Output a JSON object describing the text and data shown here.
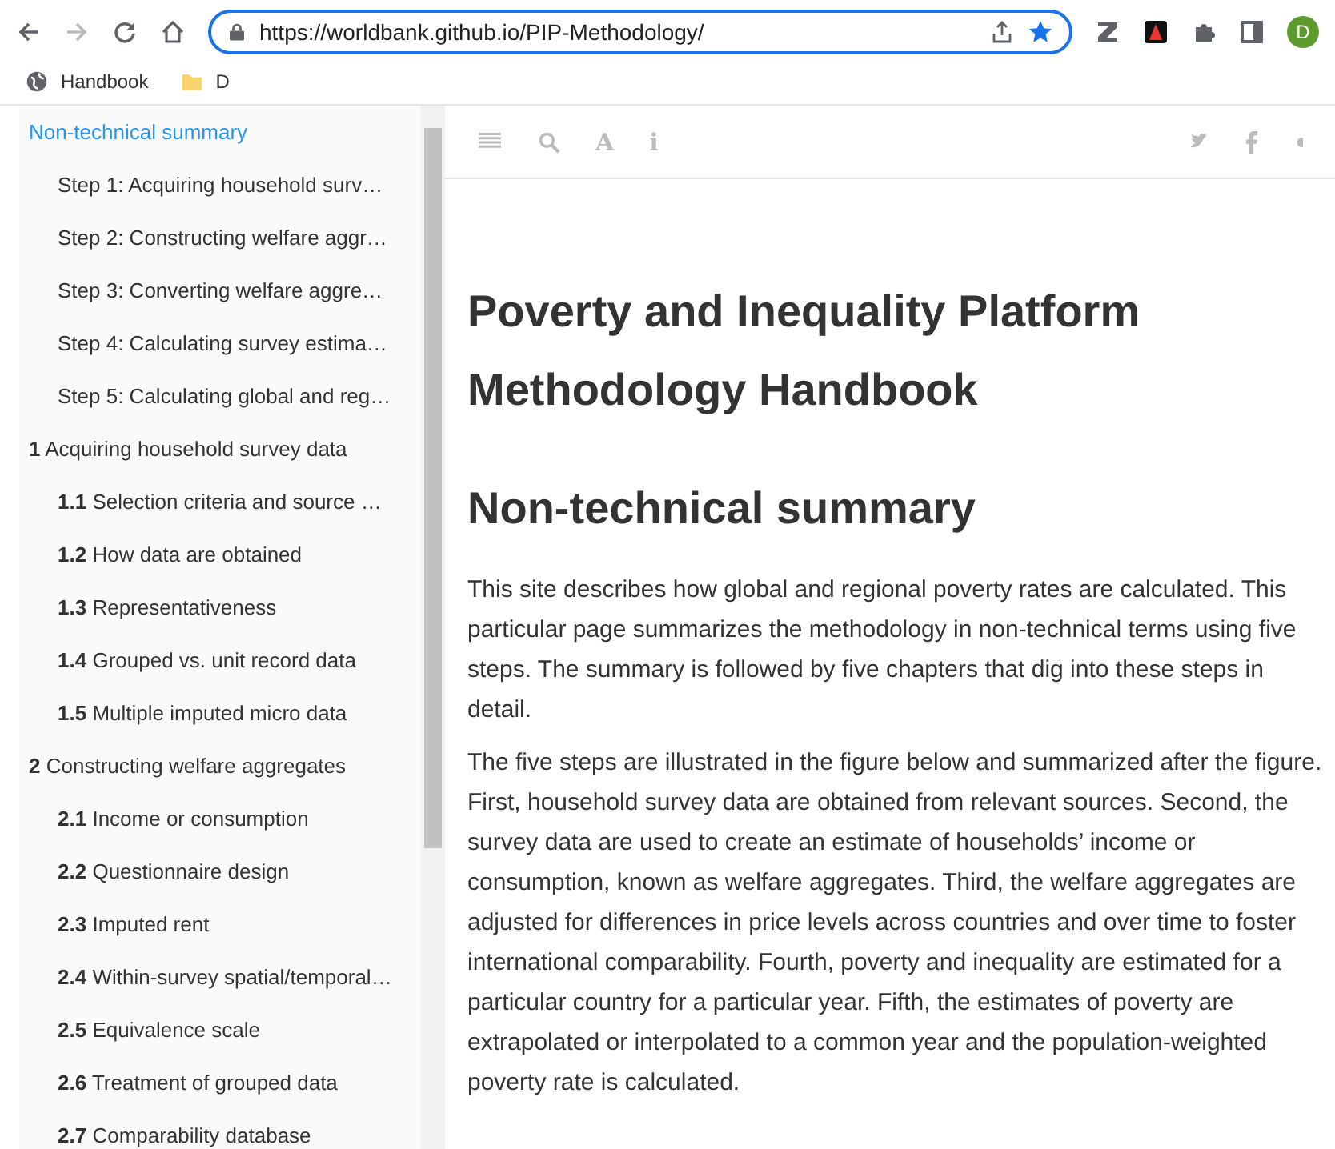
{
  "browser": {
    "url": "https://worldbank.github.io/PIP-Methodology/",
    "avatar": "D",
    "bookmarks": [
      {
        "kind": "globe",
        "label": "Handbook"
      },
      {
        "kind": "folder",
        "label": "D"
      }
    ]
  },
  "sidebar": {
    "items": [
      {
        "label": "Non-technical summary",
        "selected": true,
        "children": [
          {
            "label": "Step 1: Acquiring household surv…",
            "selected": false
          },
          {
            "label": "Step 2: Constructing welfare aggr…",
            "selected": false
          },
          {
            "label": "Step 3: Converting welfare aggre…",
            "selected": false
          },
          {
            "label": "Step 4: Calculating survey estima…",
            "selected": false
          },
          {
            "label": "Step 5: Calculating global and reg…",
            "selected": false
          }
        ]
      },
      {
        "number": "1",
        "label": "Acquiring household survey data",
        "selected": false,
        "children": [
          {
            "number": "1.1",
            "label": "Selection criteria and source …",
            "selected": false
          },
          {
            "number": "1.2",
            "label": "How data are obtained",
            "selected": false
          },
          {
            "number": "1.3",
            "label": "Representativeness",
            "selected": false
          },
          {
            "number": "1.4",
            "label": "Grouped vs. unit record data",
            "selected": false
          },
          {
            "number": "1.5",
            "label": "Multiple imputed micro data",
            "selected": false
          }
        ]
      },
      {
        "number": "2",
        "label": "Constructing welfare aggregates",
        "selected": false,
        "children": [
          {
            "number": "2.1",
            "label": "Income or consumption",
            "selected": false
          },
          {
            "number": "2.2",
            "label": "Questionnaire design",
            "selected": false
          },
          {
            "number": "2.3",
            "label": "Imputed rent",
            "selected": false
          },
          {
            "number": "2.4",
            "label": "Within-survey spatial/temporal…",
            "selected": false
          },
          {
            "number": "2.5",
            "label": "Equivalence scale",
            "selected": false
          },
          {
            "number": "2.6",
            "label": "Treatment of grouped data",
            "selected": false
          },
          {
            "number": "2.7",
            "label": "Comparability database",
            "selected": false
          }
        ]
      }
    ]
  },
  "toolbar": {
    "font_icon": "A",
    "info_icon": "i"
  },
  "content": {
    "title": "Poverty and Inequality Platform Methodology Handbook",
    "heading": "Non-technical summary",
    "paragraphs": [
      "This site describes how global and regional poverty rates are calculated. This particular page summarizes the methodology in non-technical terms using five steps. The summary is followed by five chapters that dig into these steps in detail.",
      "The five steps are illustrated in the figure below and summarized after the figure. First, household survey data are obtained from relevant sources. Second, the survey data are used to create an estimate of households’ income or consumption, known as welfare aggregates. Third, the welfare aggregates are adjusted for differences in price levels across countries and over time to foster international comparability. Fourth, poverty and inequality are estimated for a particular country for a particular year. Fifth, the estimates of poverty are extrapolated or interpolated to a common year and the population-weighted poverty rate is calculated."
    ]
  }
}
